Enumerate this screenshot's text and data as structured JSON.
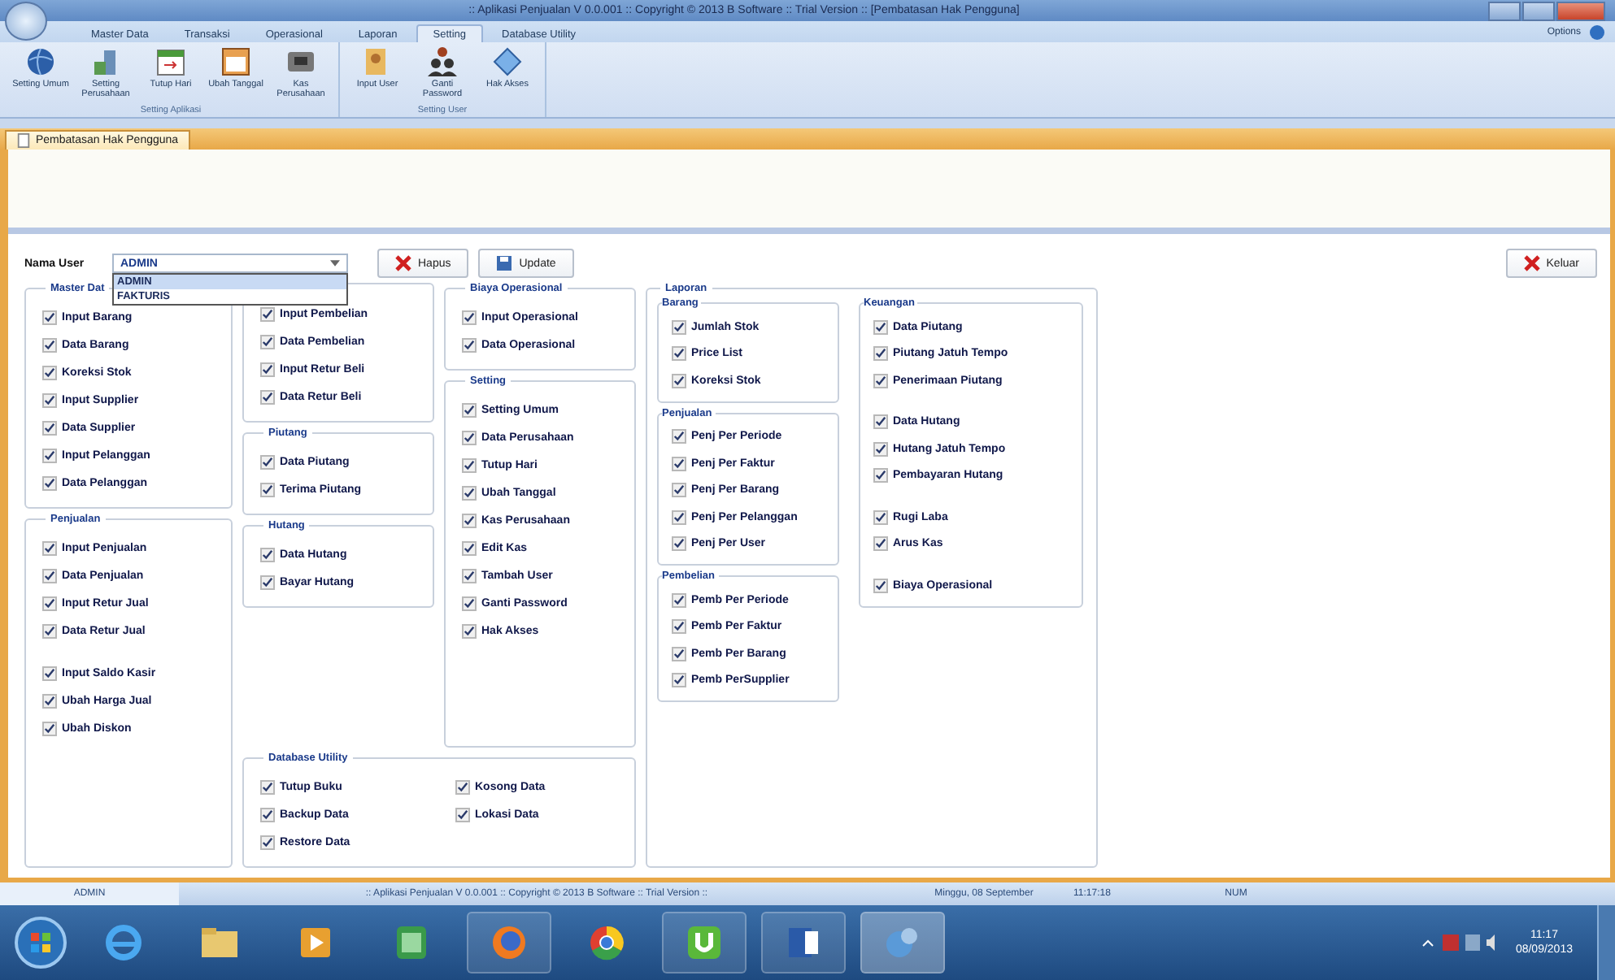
{
  "window": {
    "title": ":: Aplikasi Penjualan V 0.0.001 :: Copyright © 2013 B Software :: Trial Version :: [Pembatasan Hak Pengguna]"
  },
  "ribbon": {
    "tabs": [
      {
        "label": "Master Data",
        "selected": false
      },
      {
        "label": "Transaksi",
        "selected": false
      },
      {
        "label": "Operasional",
        "selected": false
      },
      {
        "label": "Laporan",
        "selected": false
      },
      {
        "label": "Setting",
        "selected": true
      },
      {
        "label": "Database Utility",
        "selected": false
      }
    ],
    "options": "Options",
    "groups": [
      {
        "label": "Setting Aplikasi",
        "buttons": [
          "Setting Umum",
          "Setting Perusahaan",
          "Tutup Hari",
          "Ubah Tanggal",
          "Kas Perusahaan"
        ]
      },
      {
        "label": "Setting User",
        "buttons": [
          "Input User",
          "Ganti Password",
          "Hak Akses"
        ]
      }
    ]
  },
  "doc_tab": "Pembatasan Hak Pengguna",
  "form": {
    "user_label": "Nama User",
    "user_value": "ADMIN",
    "dropdown": [
      {
        "label": "ADMIN",
        "selected": true
      },
      {
        "label": "FAKTURIS",
        "selected": false
      }
    ],
    "buttons": [
      {
        "kind": "delete",
        "label": "Hapus"
      },
      {
        "kind": "save",
        "label": "Update"
      }
    ],
    "close_button": "Keluar"
  },
  "permissions": {
    "master": {
      "title": "Master Dat",
      "sections": [
        {
          "items": [
            {
              "label": "Input Barang",
              "checked": true
            },
            {
              "label": "Data Barang",
              "checked": true
            },
            {
              "label": "Koreksi Stok",
              "checked": true
            },
            {
              "label": "Input Supplier",
              "checked": true
            },
            {
              "label": "Data Supplier",
              "checked": true
            },
            {
              "label": "Input Pelanggan",
              "checked": true
            },
            {
              "label": "Data Pelanggan",
              "checked": true
            }
          ]
        }
      ]
    },
    "sales": {
      "title": "Penjualan",
      "sections": [
        {
          "items": [
            {
              "label": "Input Penjualan",
              "checked": true
            },
            {
              "label": "Data Penjualan",
              "checked": true
            },
            {
              "label": "Input Retur Jual",
              "checked": true
            },
            {
              "label": "Data Retur Jual",
              "checked": true
            }
          ]
        },
        {
          "items": [
            {
              "label": "Input Saldo Kasir",
              "checked": true
            },
            {
              "label": "Ubah Harga Jual",
              "checked": true
            },
            {
              "label": "Ubah Diskon",
              "checked": true
            }
          ]
        }
      ]
    },
    "purchase": {
      "sections": [
        {
          "items": [
            {
              "label": "Input Pembelian",
              "checked": true
            },
            {
              "label": "Data Pembelian",
              "checked": true
            },
            {
              "label": "Input Retur Beli",
              "checked": true
            },
            {
              "label": "Data Retur Beli",
              "checked": true
            }
          ]
        }
      ]
    },
    "receivables": {
      "title": "Piutang",
      "sections": [
        {
          "items": [
            {
              "label": "Data Piutang",
              "checked": true
            },
            {
              "label": "Terima Piutang",
              "checked": true
            }
          ]
        }
      ]
    },
    "payables": {
      "title": "Hutang",
      "sections": [
        {
          "items": [
            {
              "label": "Data Hutang",
              "checked": true
            },
            {
              "label": "Bayar Hutang",
              "checked": true
            }
          ]
        }
      ]
    },
    "expenses": {
      "title": "Biaya Operasional",
      "sections": [
        {
          "items": [
            {
              "label": "Input Operasional",
              "checked": true
            },
            {
              "label": "Data Operasional",
              "checked": true
            }
          ]
        }
      ]
    },
    "settings": {
      "title": "Setting",
      "sections": [
        {
          "items": [
            {
              "label": "Setting Umum",
              "checked": true
            },
            {
              "label": "Data Perusahaan",
              "checked": true
            },
            {
              "label": "Tutup Hari",
              "checked": true
            },
            {
              "label": "Ubah Tanggal",
              "checked": true
            },
            {
              "label": "Kas Perusahaan",
              "checked": true
            },
            {
              "label": "Edit Kas",
              "checked": true
            },
            {
              "label": "Tambah User",
              "checked": true
            },
            {
              "label": "Ganti Password",
              "checked": true
            },
            {
              "label": "Hak Akses",
              "checked": true
            }
          ]
        }
      ]
    },
    "database": {
      "title": "Database Utility",
      "sections": [
        {
          "items": [
            {
              "label": "Tutup Buku",
              "checked": true
            },
            {
              "label": "Backup Data",
              "checked": true
            },
            {
              "label": "Restore Data",
              "checked": true
            },
            {
              "label": "Kosong Data",
              "checked": true
            },
            {
              "label": "Lokasi Data",
              "checked": true
            }
          ]
        }
      ]
    },
    "reports": {
      "title": "Laporan",
      "groups": [
        {
          "title": "Barang",
          "sections": [
            {
              "items": [
                {
                  "label": "Jumlah Stok",
                  "checked": true
                },
                {
                  "label": "Price List",
                  "checked": true
                },
                {
                  "label": "Koreksi Stok",
                  "checked": true
                }
              ]
            }
          ]
        },
        {
          "title": "Penjualan",
          "sections": [
            {
              "items": [
                {
                  "label": "Penj Per Periode",
                  "checked": true
                },
                {
                  "label": "Penj Per Faktur",
                  "checked": true
                },
                {
                  "label": "Penj Per Barang",
                  "checked": true
                },
                {
                  "label": "Penj Per Pelanggan",
                  "checked": true
                },
                {
                  "label": "Penj Per User",
                  "checked": true
                }
              ]
            }
          ]
        },
        {
          "title": "Pembelian",
          "sections": [
            {
              "items": [
                {
                  "label": "Pemb Per Periode",
                  "checked": true
                },
                {
                  "label": "Pemb Per Faktur",
                  "checked": true
                },
                {
                  "label": "Pemb Per Barang",
                  "checked": true
                },
                {
                  "label": "Pemb PerSupplier",
                  "checked": true
                }
              ]
            }
          ]
        },
        {
          "title": "Keuangan",
          "sections": [
            {
              "items": [
                {
                  "label": "Data Piutang",
                  "checked": true
                },
                {
                  "label": "Piutang Jatuh Tempo",
                  "checked": true
                },
                {
                  "label": "Penerimaan Piutang",
                  "checked": true
                }
              ]
            },
            {
              "items": [
                {
                  "label": "Data Hutang",
                  "checked": true
                },
                {
                  "label": "Hutang Jatuh Tempo",
                  "checked": true
                },
                {
                  "label": "Pembayaran Hutang",
                  "checked": true
                }
              ]
            },
            {
              "items": [
                {
                  "label": "Rugi Laba",
                  "checked": true
                },
                {
                  "label": "Arus Kas",
                  "checked": true
                }
              ]
            },
            {
              "items": [
                {
                  "label": "Biaya Operasional",
                  "checked": true
                }
              ]
            }
          ]
        }
      ]
    }
  },
  "status_bar": {
    "user": "ADMIN",
    "info": ":: Aplikasi Penjualan V 0.0.001 :: Copyright © 2013 B Software :: Trial Version ::",
    "date": "Minggu, 08 September",
    "time": "11:17:18",
    "keys": "NUM"
  },
  "taskbar": {
    "time": "11:17",
    "date": "08/09/2013"
  }
}
